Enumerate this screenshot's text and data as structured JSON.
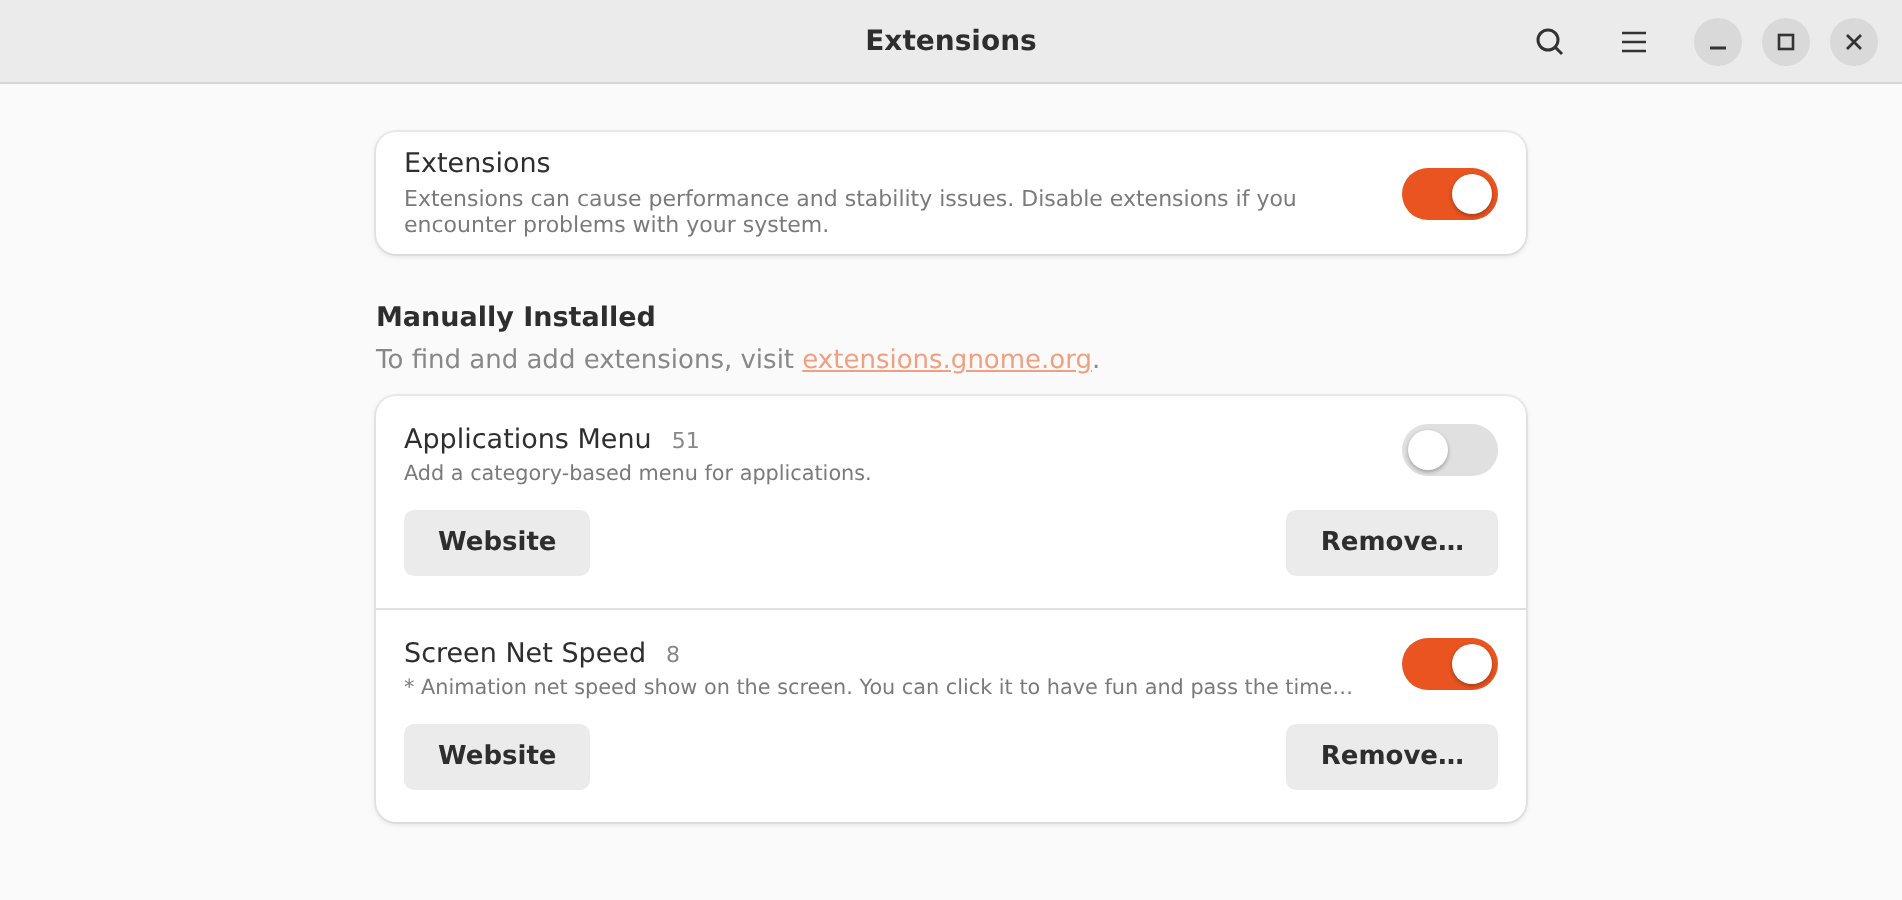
{
  "window": {
    "title": "Extensions"
  },
  "master": {
    "title": "Extensions",
    "description": "Extensions can cause performance and stability issues. Disable extensions if you encounter problems with your system.",
    "on": true
  },
  "section": {
    "heading": "Manually Installed",
    "hint_prefix": "To find and add extensions, visit ",
    "link": "extensions.gnome.org",
    "hint_suffix": "."
  },
  "extensions": [
    {
      "name": "Applications Menu",
      "version": "51",
      "description": "Add a category-based menu for applications.",
      "on": false,
      "website": "Website",
      "remove": "Remove…"
    },
    {
      "name": "Screen Net Speed",
      "version": "8",
      "description": "* Animation net speed show on the screen. You can click it to have fun and pass the time…",
      "on": true,
      "website": "Website",
      "remove": "Remove…"
    }
  ]
}
